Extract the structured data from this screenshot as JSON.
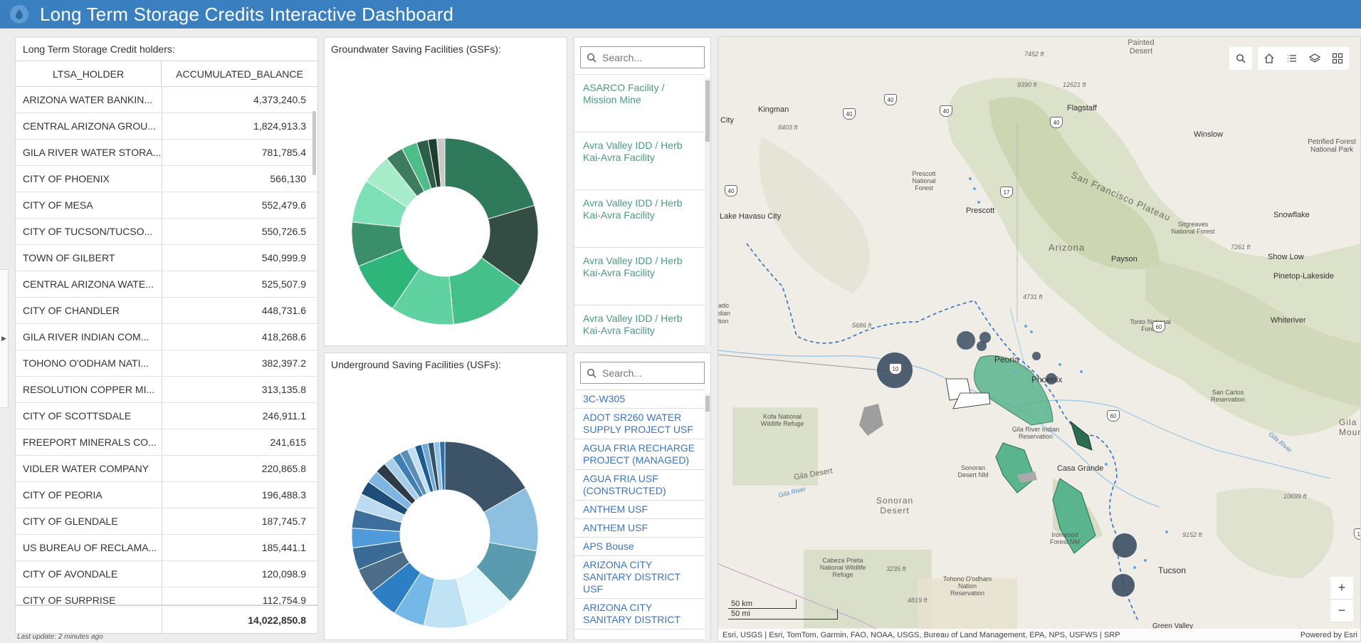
{
  "header": {
    "title": "Long Term Storage Credits Interactive Dashboard"
  },
  "table": {
    "title": "Long Term Storage Credit holders:",
    "col1": "LTSA_HOLDER",
    "col2": "ACCUMULATED_BALANCE",
    "rows": [
      {
        "holder": "ARIZONA WATER BANKIN...",
        "balance": "4,373,240.5"
      },
      {
        "holder": "CENTRAL ARIZONA GROU...",
        "balance": "1,824,913.3"
      },
      {
        "holder": "GILA RIVER WATER STORA...",
        "balance": "781,785.4"
      },
      {
        "holder": "CITY OF PHOENIX",
        "balance": "566,130"
      },
      {
        "holder": "CITY OF MESA",
        "balance": "552,479.6"
      },
      {
        "holder": "CITY OF TUCSON/TUCSO...",
        "balance": "550,726.5"
      },
      {
        "holder": "TOWN OF GILBERT",
        "balance": "540,999.9"
      },
      {
        "holder": "CENTRAL ARIZONA WATE...",
        "balance": "525,507.9"
      },
      {
        "holder": "CITY OF CHANDLER",
        "balance": "448,731.6"
      },
      {
        "holder": "GILA RIVER INDIAN COM...",
        "balance": "418,268.6"
      },
      {
        "holder": "TOHONO O'ODHAM NATI...",
        "balance": "382,397.2"
      },
      {
        "holder": "RESOLUTION COPPER MI...",
        "balance": "313,135.8"
      },
      {
        "holder": "CITY OF SCOTTSDALE",
        "balance": "246,911.1"
      },
      {
        "holder": "FREEPORT MINERALS CO...",
        "balance": "241,615"
      },
      {
        "holder": "VIDLER WATER COMPANY",
        "balance": "220,865.8"
      },
      {
        "holder": "CITY OF PEORIA",
        "balance": "196,488.3"
      },
      {
        "holder": "CITY OF GLENDALE",
        "balance": "187,745.7"
      },
      {
        "holder": "US BUREAU OF RECLAMA...",
        "balance": "185,441.1"
      },
      {
        "holder": "CITY OF AVONDALE",
        "balance": "120,098.9"
      },
      {
        "holder": "CITY OF SURPRISE",
        "balance": "112,754.9"
      }
    ],
    "total": "14,022,850.8",
    "last_update": "Last update: 2 minutes ago"
  },
  "gsf_chart": {
    "title": "Groundwater Saving Facilities (GSFs):"
  },
  "usf_chart": {
    "title": "Underground Saving Facilities (USFs):"
  },
  "gsf_list": {
    "search_placeholder": "Search...",
    "items": [
      "ASARCO Facility / Mission Mine",
      "Avra Valley IDD / Herb Kai-Avra Facility",
      "Avra Valley IDD / Herb Kai-Avra Facility",
      "Avra Valley IDD / Herb Kai-Avra Facility",
      "Avra Valley IDD / Herb Kai-Avra Facility"
    ]
  },
  "usf_list": {
    "search_placeholder": "Search...",
    "items": [
      "3C-W305",
      "ADOT SR260 WATER SUPPLY PROJECT USF",
      "AGUA FRIA RECHARGE PROJECT (MANAGED)",
      "AGUA FRIA USF (CONSTRUCTED)",
      "ANTHEM USF",
      "ANTHEM USF",
      "APS Bouse",
      "ARIZONA CITY SANITARY DISTRICT USF",
      "ARIZONA CITY SANITARY DISTRICT"
    ]
  },
  "chart_data": [
    {
      "type": "pie",
      "title": "Groundwater Saving Facilities (GSFs):",
      "colors": [
        "#2e7a5a",
        "#334d45",
        "#46c08a",
        "#60d1a0",
        "#2db57a",
        "#3a8e69",
        "#7de0b6",
        "#a6ecc9",
        "#3e7c5f",
        "#4fbd8a",
        "#2d5e4a",
        "#1f3d30",
        "#c9c9c9"
      ],
      "values": [
        20.5,
        14.4,
        13.6,
        11.0,
        9.4,
        7.7,
        7.5,
        5.2,
        3.1,
        2.7,
        2.0,
        1.5,
        1.4
      ]
    },
    {
      "type": "pie",
      "title": "Underground Saving Facilities (USFs):",
      "colors": [
        "#3d5468",
        "#8cbfe0",
        "#5a9bb0",
        "#e5f6fd",
        "#bfe2f5",
        "#74b8e8",
        "#2b7fc2",
        "#4c6d8a",
        "#3a6a96",
        "#4f9ad8",
        "#3e6f9c",
        "#bcdcf1",
        "#1e4d7a",
        "#7fb5e2",
        "#2d3a47",
        "#a6cdea",
        "#3f7fb8",
        "#5a8cb8",
        "#c2dff2",
        "#1d5a8e",
        "#6ea9d8",
        "#35506a",
        "#8ec2e6",
        "#2a6fb0"
      ],
      "values": [
        16.5,
        11.0,
        9.8,
        8.2,
        7.6,
        5.4,
        5.3,
        4.4,
        3.8,
        3.4,
        3.2,
        2.8,
        2.4,
        2.2,
        1.9,
        1.7,
        1.5,
        1.4,
        1.3,
        1.2,
        1.1,
        1.0,
        1.0,
        0.9
      ]
    }
  ],
  "map": {
    "attribution": "Esri, USGS | Esri, TomTom, Garmin, FAO, NOAA, USGS, Bureau of Land Management, EPA, NPS, USFWS | SRP",
    "powered": "Powered by Esri",
    "scale_km": "50 km",
    "scale_mi": "50 mi",
    "labels": {
      "painted_desert": "Painted Desert",
      "kingman": "Kingman",
      "flagstaff": "Flagstaff",
      "winslow": "Winslow",
      "petrified": "Petrified Forest National Park",
      "city": "City",
      "prescott_nf": "Prescott National Forest",
      "sf_plateau": "San Francisco Plateau",
      "prescott": "Prescott",
      "lake_havasu": "Lake Havasu City",
      "arizona": "Arizona",
      "sitgreaves": "Sitgreaves National Forest",
      "snowflake": "Snowflake",
      "payson": "Payson",
      "show_low": "Show Low",
      "pinetop": "Pinetop-Lakeside",
      "ado": "ado dian tion",
      "tonto": "Tonto National Forest",
      "whiteriver": "Whiteriver",
      "peoria": "Peoria",
      "phoenix": "Phoenix",
      "kofa": "Kofa National Wildlife Refuge",
      "san_carlos": "San Carlos Reservation",
      "gila_indian": "Gila River Indian Reservation",
      "gila_desert": "Gila Desert",
      "gila_river": "Gila River",
      "gila_river2": "Gila River",
      "sonoran_nm": "Sonoran Desert NM",
      "casa_grande": "Casa Grande",
      "sonoran": "Sonoran Desert",
      "mountain": "Gila Mounta",
      "ironwood": "Ironwood Forest NM",
      "cabeza": "Cabeza Prieta National Wildlife Refuge",
      "tohono": "Tohono O'odham Nation Reservation",
      "tucson": "Tucson",
      "green_valley": "Green Valley",
      "e7452": "7452 ft",
      "e9390": "9390 ft",
      "e12621": "12621 ft",
      "e8403": "8403 ft",
      "e7261": "7261 ft",
      "e4731": "4731 ft",
      "e5686": "5686 ft",
      "e10699": "10699 ft",
      "e9152": "9152 ft",
      "e3235": "3235 ft",
      "e4819": "4819 ft"
    },
    "highways": [
      "40",
      "40",
      "40",
      "40",
      "40",
      "17",
      "10",
      "60",
      "60",
      "10"
    ]
  }
}
